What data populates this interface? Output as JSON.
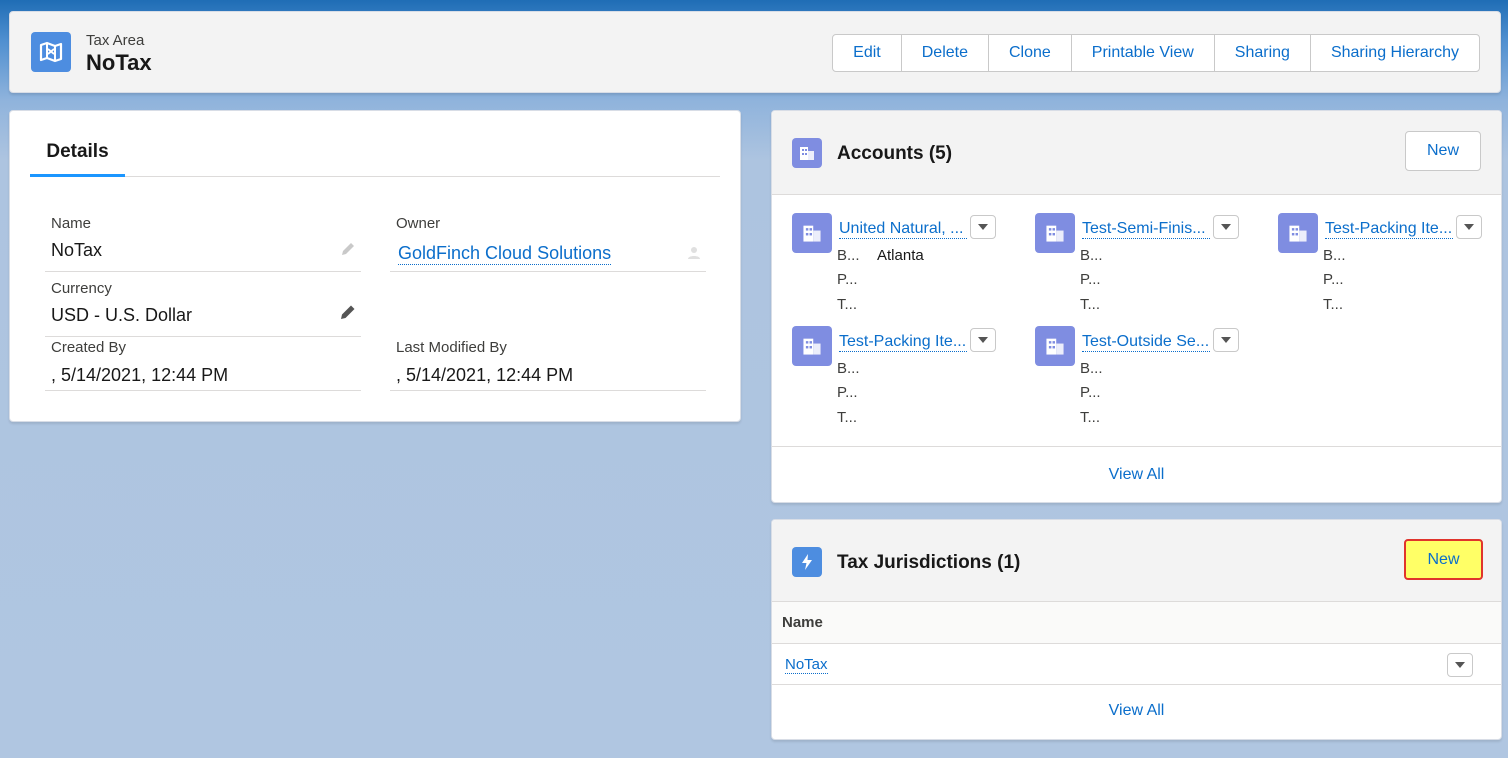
{
  "header": {
    "object_type": "Tax Area",
    "record_name": "NoTax",
    "object_icon": "tax-area-map-icon",
    "actions": [
      "Edit",
      "Delete",
      "Clone",
      "Printable View",
      "Sharing",
      "Sharing Hierarchy"
    ]
  },
  "details": {
    "tab_label": "Details",
    "name_label": "Name",
    "name_value": "NoTax",
    "owner_label": "Owner",
    "owner_value": "GoldFinch Cloud Solutions",
    "currency_label": "Currency",
    "currency_value": "USD - U.S. Dollar",
    "created_by_label": "Created By",
    "created_by_value": ", 5/14/2021, 12:44 PM",
    "last_modified_label": "Last Modified By",
    "last_modified_value": ", 5/14/2021, 12:44 PM"
  },
  "accounts": {
    "title": "Accounts (5)",
    "new_label": "New",
    "view_all_label": "View All",
    "items": [
      {
        "name": "United Natural, ...",
        "row1_label": "B...",
        "row1_value": "Atlanta",
        "row2_label": "P...",
        "row3_label": "T..."
      },
      {
        "name": "Test-Semi-Finis...",
        "row1_label": "B...",
        "row1_value": "",
        "row2_label": "P...",
        "row3_label": "T..."
      },
      {
        "name": "Test-Packing Ite...",
        "row1_label": "B...",
        "row1_value": "",
        "row2_label": "P...",
        "row3_label": "T..."
      },
      {
        "name": "Test-Packing Ite...",
        "row1_label": "B...",
        "row1_value": "",
        "row2_label": "P...",
        "row3_label": "T..."
      },
      {
        "name": "Test-Outside Se...",
        "row1_label": "B...",
        "row1_value": "",
        "row2_label": "P...",
        "row3_label": "T..."
      }
    ]
  },
  "tax_jurisdictions": {
    "title": "Tax Jurisdictions (1)",
    "new_label": "New",
    "column_name": "Name",
    "rows": [
      "NoTax"
    ],
    "view_all_label": "View All"
  },
  "colors": {
    "link": "#0b6ecb",
    "highlight": "#ffff66",
    "highlight_border": "#e0342c",
    "account_icon": "#7f8de1",
    "jurisdiction_icon": "#4d8de0"
  }
}
